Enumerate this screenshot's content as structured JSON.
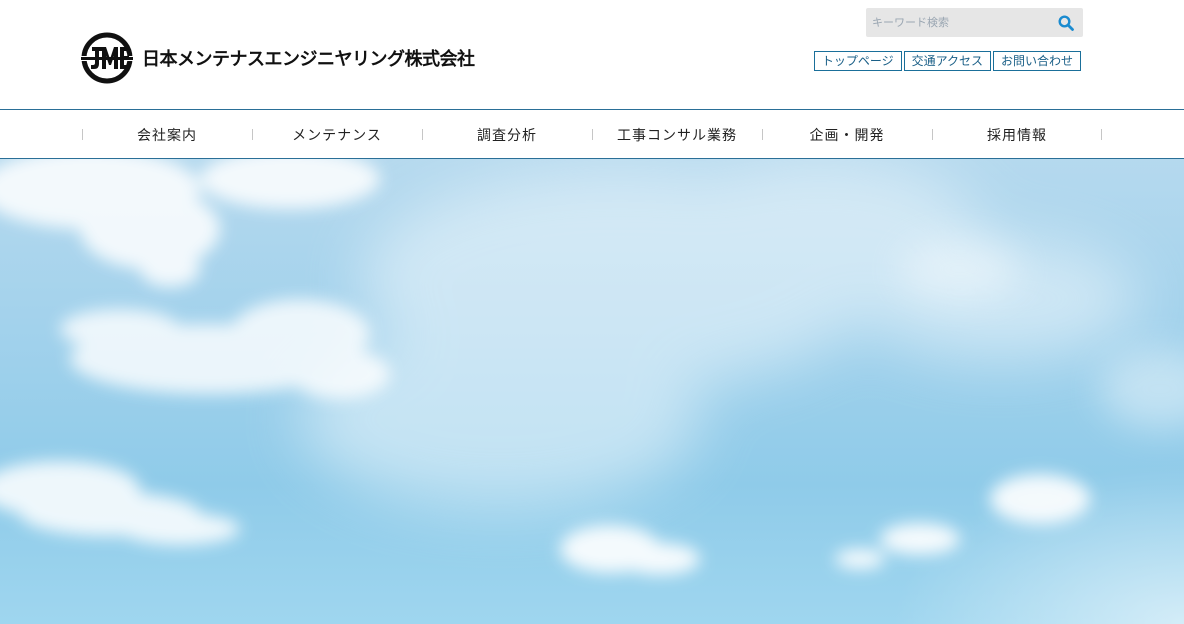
{
  "company": {
    "name": "日本メンテナスエンジニヤリング株式会社",
    "logo_icon": "jme-circle-logo-icon"
  },
  "search": {
    "placeholder": "キーワード検索",
    "value": "",
    "icon": "search-icon"
  },
  "utility_links": [
    {
      "label": "トップページ"
    },
    {
      "label": "交通アクセス"
    },
    {
      "label": "お問い合わせ"
    }
  ],
  "nav": {
    "items": [
      {
        "label": "会社案内"
      },
      {
        "label": "メンテナンス"
      },
      {
        "label": "調査分析"
      },
      {
        "label": "工事コンサル業務"
      },
      {
        "label": "企画・開発"
      },
      {
        "label": "採用情報"
      }
    ]
  },
  "colors": {
    "accent": "#1a6f9a",
    "search_icon": "#1a8bd0",
    "sky": "#8fcbe9"
  }
}
